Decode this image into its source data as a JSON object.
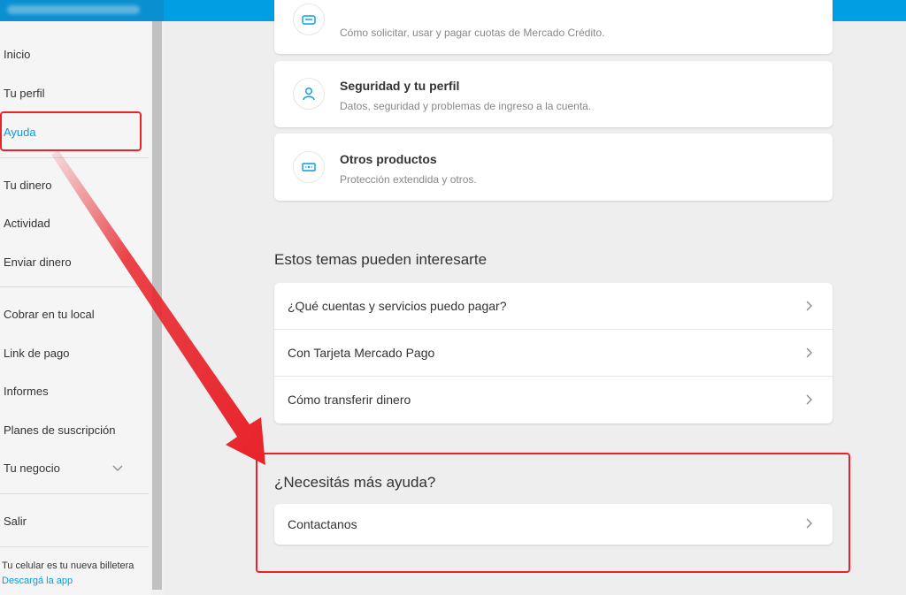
{
  "sidebar": {
    "items": [
      {
        "label": "Inicio"
      },
      {
        "label": "Tu perfil"
      },
      {
        "label": "Ayuda"
      },
      {
        "label": "Tu dinero"
      },
      {
        "label": "Actividad"
      },
      {
        "label": "Enviar dinero"
      },
      {
        "label": "Cobrar en tu local"
      },
      {
        "label": "Link de pago"
      },
      {
        "label": "Informes"
      },
      {
        "label": "Planes de suscripción"
      },
      {
        "label": "Tu negocio"
      },
      {
        "label": "Salir"
      }
    ],
    "active": "Ayuda",
    "promo_text": "Tu celular es tu nueva billetera",
    "promo_link": "Descargá la app"
  },
  "cards": [
    {
      "title": "",
      "desc": "Cómo solicitar, usar y pagar cuotas de Mercado Crédito.",
      "icon": "credit-icon"
    },
    {
      "title": "Seguridad y tu perfil",
      "desc": "Datos, seguridad y problemas de ingreso a la cuenta.",
      "icon": "user-icon"
    },
    {
      "title": "Otros productos",
      "desc": "Protección extendida y otros.",
      "icon": "ticket-icon"
    }
  ],
  "topics": {
    "title": "Estos temas pueden interesarte",
    "items": [
      {
        "label": "¿Qué cuentas y servicios puedo pagar?"
      },
      {
        "label": "Con Tarjeta Mercado Pago"
      },
      {
        "label": "Cómo transferir dinero"
      }
    ]
  },
  "help": {
    "title": "¿Necesitás más ayuda?",
    "contact_label": "Contactanos"
  },
  "colors": {
    "accent": "#009ee3",
    "annotation": "#e8232a"
  }
}
